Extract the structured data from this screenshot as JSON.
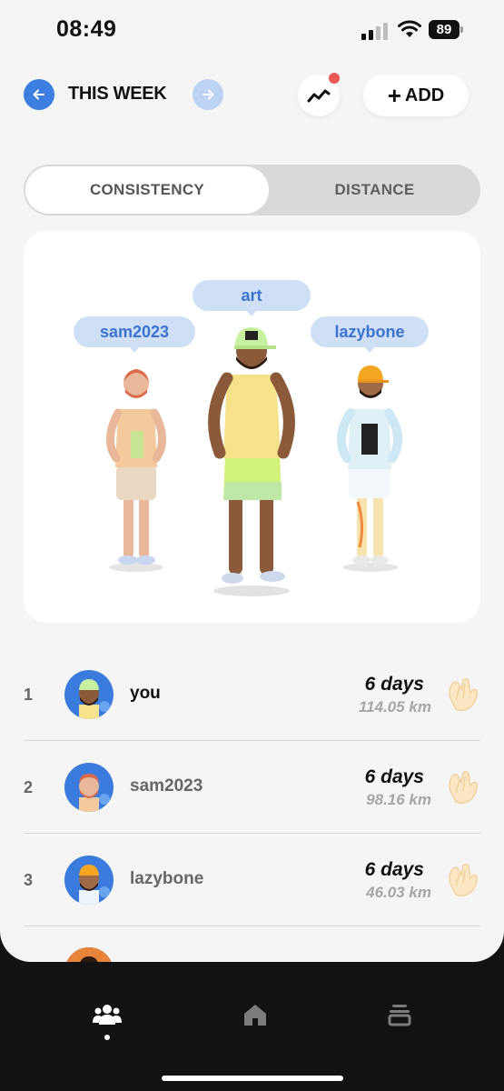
{
  "status": {
    "time": "08:49",
    "battery": "89"
  },
  "header": {
    "title": "THIS WEEK",
    "add_label": "ADD"
  },
  "segment": {
    "active": "CONSISTENCY",
    "inactive": "DISTANCE"
  },
  "podium": {
    "left": "sam2023",
    "center": "art",
    "right": "lazybone"
  },
  "leaderboard": [
    {
      "rank": "1",
      "name": "you",
      "days": "6 days",
      "distance": "114.05 km"
    },
    {
      "rank": "2",
      "name": "sam2023",
      "days": "6 days",
      "distance": "98.16 km"
    },
    {
      "rank": "3",
      "name": "lazybone",
      "days": "6 days",
      "distance": "46.03 km"
    }
  ],
  "colors": {
    "accent": "#3d7fe0",
    "bubble": "#cfe0f6",
    "notification": "#e95757"
  },
  "icons": [
    "arrow-left-icon",
    "arrow-right-icon",
    "trend-chart-icon",
    "clap-icon",
    "group-icon",
    "home-icon",
    "stack-icon"
  ]
}
